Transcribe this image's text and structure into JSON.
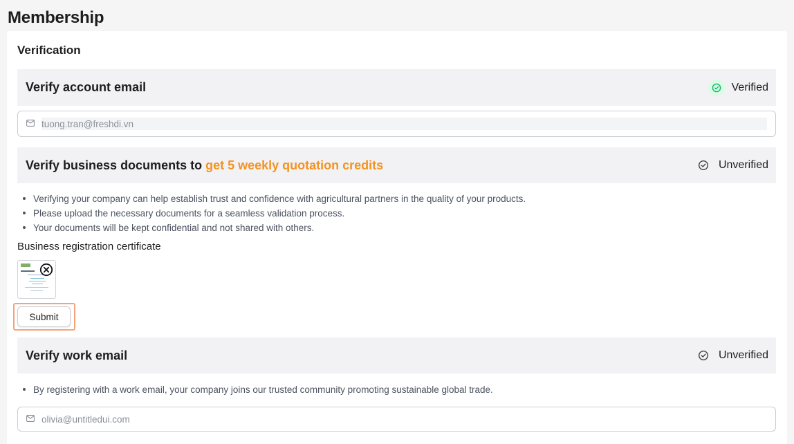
{
  "page": {
    "title": "Membership"
  },
  "card": {
    "section_title": "Verification"
  },
  "account_email": {
    "title": "Verify account email",
    "status": "Verified",
    "status_color": "#12b76a",
    "email_value": "tuong.tran@freshdi.vn",
    "icon": "mail-icon"
  },
  "business_docs": {
    "title_prefix": "Verify business documents to ",
    "title_accent": "get 5 weekly quotation credits",
    "accent_color": "#f39322",
    "status": "Unverified",
    "bullets": [
      "Verifying your company can help establish trust and confidence with agricultural partners in the quality of your products.",
      "Please upload the necessary documents for a seamless validation process.",
      "Your documents will be kept confidential and not shared with others."
    ],
    "certificate_label": "Business registration certificate",
    "submit_label": "Submit"
  },
  "work_email": {
    "title": "Verify work email",
    "status": "Unverified",
    "bullets": [
      "By registering with a work email, your company joins our trusted community promoting sustainable global trade."
    ],
    "email_placeholder": "olivia@untitledui.com",
    "icon": "mail-icon"
  }
}
